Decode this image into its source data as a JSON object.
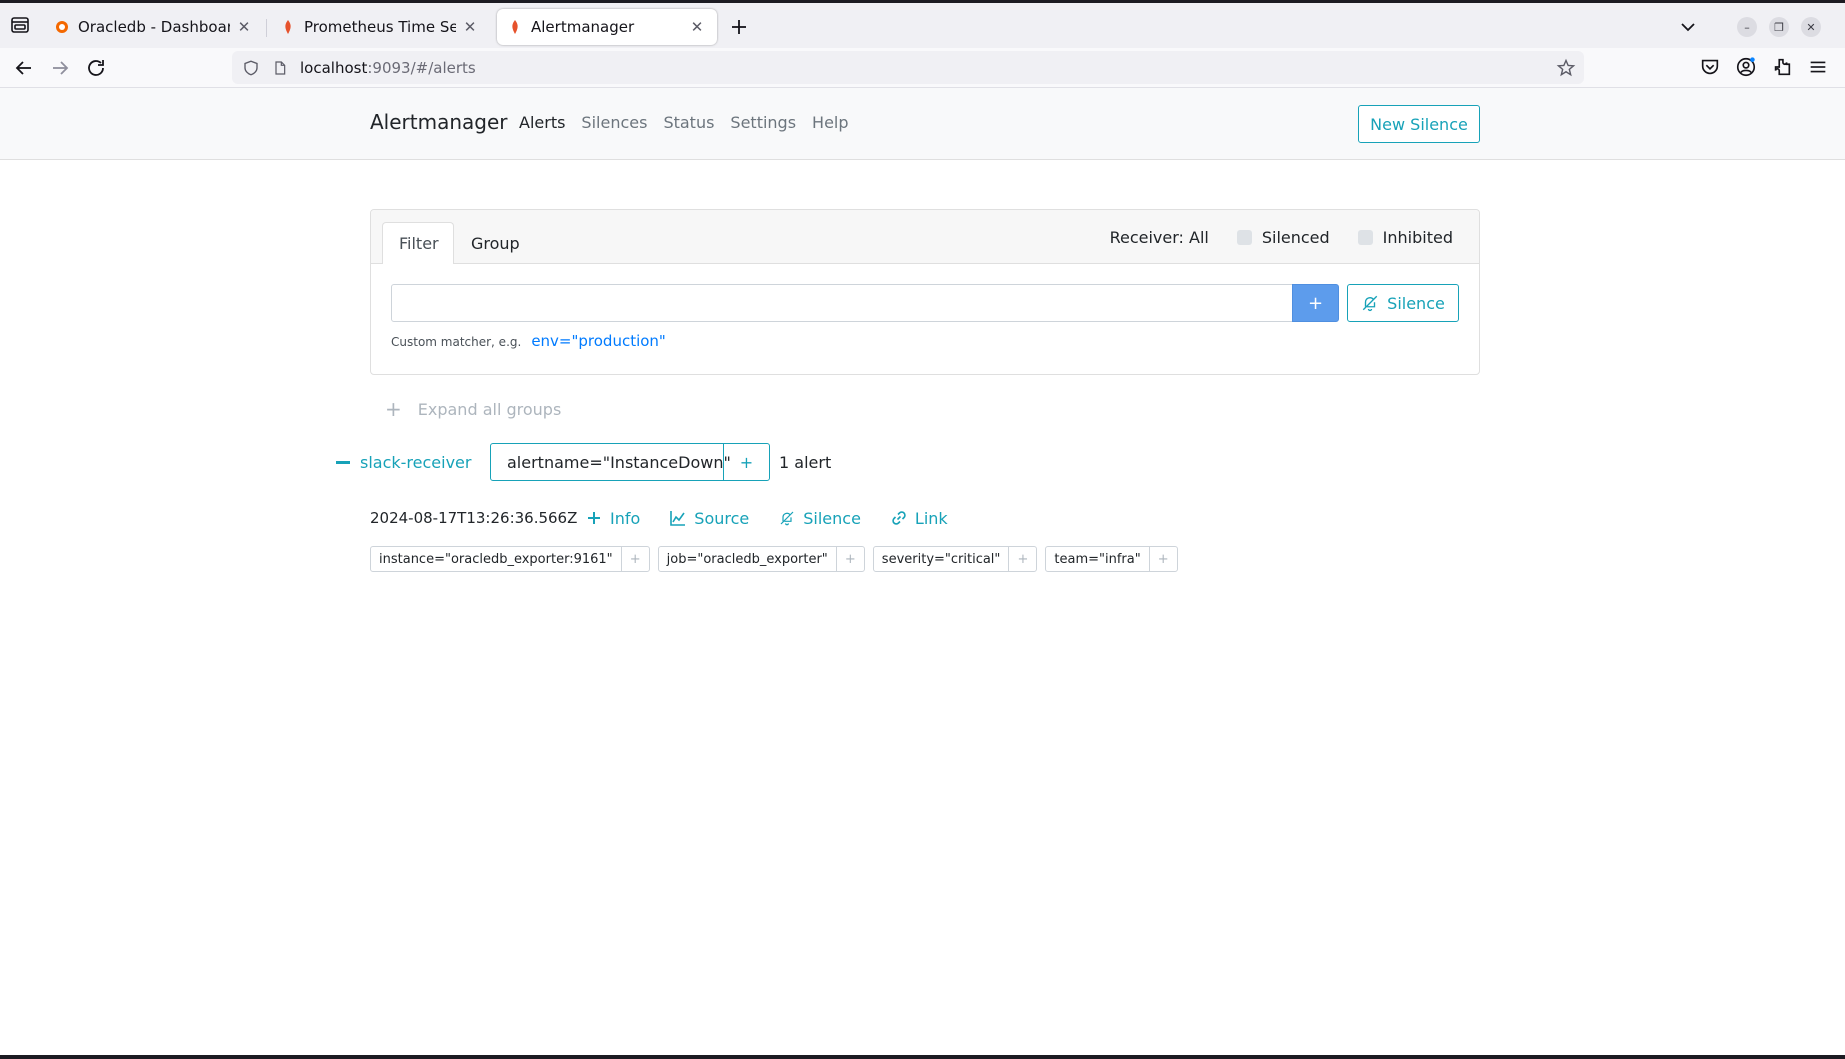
{
  "browser": {
    "tabs": [
      {
        "title": "Oracledb - Dashboards - Grafana"
      },
      {
        "title": "Prometheus Time Series Collection"
      },
      {
        "title": "Alertmanager"
      }
    ],
    "url": {
      "host": "localhost",
      "rest": ":9093/#/alerts"
    }
  },
  "app": {
    "brand": "Alertmanager",
    "nav": [
      "Alerts",
      "Silences",
      "Status",
      "Settings",
      "Help"
    ],
    "new_silence": "New Silence"
  },
  "filter": {
    "tabs": [
      "Filter",
      "Group"
    ],
    "receiver": "Receiver: All",
    "silenced": "Silenced",
    "inhibited": "Inhibited",
    "input_value": "",
    "plus": "+",
    "silence": "Silence",
    "hint": "Custom matcher, e.g.",
    "hint_example": "env=\"production\""
  },
  "expand_all": "Expand all groups",
  "group": {
    "receiver": "slack-receiver",
    "label": "alertname=\"InstanceDown\"",
    "plus": "+",
    "count": "1 alert"
  },
  "alert": {
    "timestamp": "2024-08-17T13:26:36.566Z",
    "actions": [
      "Info",
      "Source",
      "Silence",
      "Link"
    ],
    "labels": [
      "instance=\"oracledb_exporter:9161\"",
      "job=\"oracledb_exporter\"",
      "severity=\"critical\"",
      "team=\"infra\""
    ],
    "label_plus": "+"
  },
  "colors": {
    "accent": "#17a2b8",
    "primary": "#5d9cec",
    "link": "#007bff"
  }
}
